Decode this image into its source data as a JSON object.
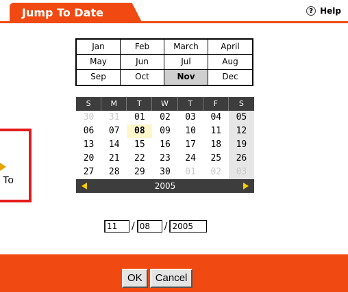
{
  "header": {
    "title": "Jump To Date",
    "help_label": "Help",
    "help_icon": "?"
  },
  "left_panel": {
    "label": "To"
  },
  "months": [
    {
      "label": "Jan",
      "selected": false
    },
    {
      "label": "Feb",
      "selected": false
    },
    {
      "label": "March",
      "selected": false
    },
    {
      "label": "April",
      "selected": false
    },
    {
      "label": "May",
      "selected": false
    },
    {
      "label": "Jun",
      "selected": false
    },
    {
      "label": "Jul",
      "selected": false
    },
    {
      "label": "Aug",
      "selected": false
    },
    {
      "label": "Sep",
      "selected": false
    },
    {
      "label": "Oct",
      "selected": false
    },
    {
      "label": "Nov",
      "selected": true
    },
    {
      "label": "Dec",
      "selected": false
    }
  ],
  "calendar": {
    "weekdays": [
      "S",
      "M",
      "T",
      "W",
      "T",
      "F",
      "S"
    ],
    "days": [
      {
        "d": "30",
        "other": true
      },
      {
        "d": "31",
        "other": true
      },
      {
        "d": "01"
      },
      {
        "d": "02"
      },
      {
        "d": "03"
      },
      {
        "d": "04"
      },
      {
        "d": "05",
        "sat": true
      },
      {
        "d": "06"
      },
      {
        "d": "07"
      },
      {
        "d": "08",
        "today": true
      },
      {
        "d": "09"
      },
      {
        "d": "10"
      },
      {
        "d": "11"
      },
      {
        "d": "12",
        "sat": true
      },
      {
        "d": "13"
      },
      {
        "d": "14"
      },
      {
        "d": "15"
      },
      {
        "d": "16"
      },
      {
        "d": "17"
      },
      {
        "d": "18"
      },
      {
        "d": "19",
        "sat": true
      },
      {
        "d": "20"
      },
      {
        "d": "21"
      },
      {
        "d": "22"
      },
      {
        "d": "23"
      },
      {
        "d": "24"
      },
      {
        "d": "25"
      },
      {
        "d": "26",
        "sat": true
      },
      {
        "d": "27"
      },
      {
        "d": "28"
      },
      {
        "d": "29"
      },
      {
        "d": "30"
      },
      {
        "d": "01",
        "other": true
      },
      {
        "d": "02",
        "other": true
      },
      {
        "d": "03",
        "other": true,
        "sat": true
      }
    ],
    "year": "2005"
  },
  "date_fields": {
    "month": "11",
    "day": "08",
    "year": "2005",
    "separator": "/"
  },
  "buttons": {
    "ok": "OK",
    "cancel": "Cancel"
  },
  "colors": {
    "accent": "#f04a12",
    "dark_bar": "#3d3d3d",
    "today_bg": "#fff7c9",
    "nav_arrow": "#ffcc00",
    "red_box": "#e31b1b"
  }
}
